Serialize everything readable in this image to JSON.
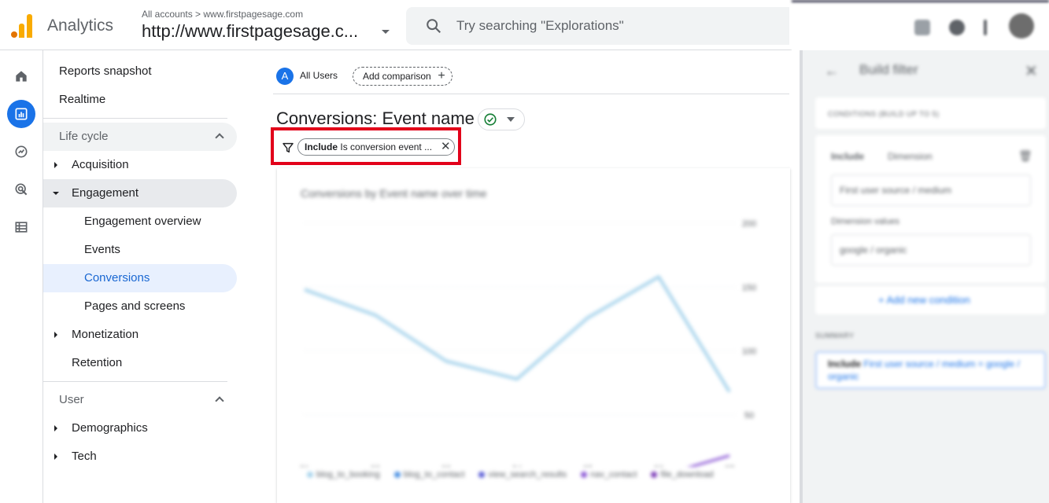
{
  "topbar": {
    "app_name": "Analytics",
    "account_crumb": "All accounts > www.firstpagesage.com",
    "property": "http://www.firstpagesage.c...",
    "search_placeholder": "Try searching \"Explorations\""
  },
  "nav": {
    "reports_snapshot": "Reports snapshot",
    "realtime": "Realtime",
    "lifecycle": "Life cycle",
    "acquisition": "Acquisition",
    "engagement": "Engagement",
    "engagement_overview": "Engagement overview",
    "events": "Events",
    "conversions": "Conversions",
    "pages_and_screens": "Pages and screens",
    "monetization": "Monetization",
    "retention": "Retention",
    "user": "User",
    "demographics": "Demographics",
    "tech": "Tech"
  },
  "main": {
    "comparison_avatar": "A",
    "all_users": "All Users",
    "add_comparison": "Add comparison",
    "report_title": "Conversions: Event name",
    "filter_include": "Include",
    "filter_text": "Is conversion event ...",
    "chart_title": "Conversions by Event name over time"
  },
  "chart_data": {
    "type": "line",
    "x": [
      "21 Jul",
      "22",
      "23",
      "24",
      "25",
      "26",
      "27"
    ],
    "x_ticks": [
      "21",
      "22",
      "23",
      "24",
      "25",
      "26",
      "27"
    ],
    "x_month": "Jul",
    "y_ticks": [
      "200",
      "150",
      "100",
      "50",
      "0"
    ],
    "ylim": [
      0,
      200
    ],
    "series": [
      {
        "name": "blog_to_booking",
        "color": "#a8d4ec",
        "values": [
          148,
          128,
          92,
          78,
          126,
          158,
          68
        ]
      },
      {
        "name": "blog_to_contact",
        "color": "#4a90e2",
        "values": [
          2,
          4,
          1,
          1,
          1,
          2,
          1
        ]
      },
      {
        "name": "view_search_results",
        "color": "#5b5fd6",
        "values": [
          1,
          2,
          1,
          1,
          1,
          1,
          1
        ]
      },
      {
        "name": "nav_contact",
        "color": "#8e5bd6",
        "values": [
          1,
          1,
          1,
          1,
          1,
          2,
          18
        ]
      },
      {
        "name": "file_download",
        "color": "#7e3fb8",
        "values": [
          1,
          1,
          0,
          0,
          1,
          1,
          1
        ]
      }
    ]
  },
  "right_panel": {
    "title": "Build filter",
    "conditions_label": "CONDITIONS (BUILD UP TO 5)",
    "include": "Include",
    "dimension": "Dimension",
    "dimension_value": "First user source / medium",
    "dimension_values_label": "Dimension values",
    "value": "google / organic",
    "add_condition": "Add new condition",
    "summary_label": "SUMMARY",
    "summary_include": "Include",
    "summary_text": "First user source / medium = google / organic"
  }
}
